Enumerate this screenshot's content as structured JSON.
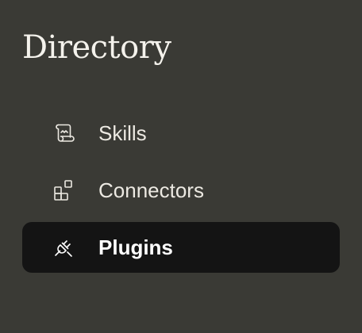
{
  "page": {
    "title": "Directory"
  },
  "nav": {
    "items": [
      {
        "label": "Skills",
        "icon": "scroll-icon",
        "active": false
      },
      {
        "label": "Connectors",
        "icon": "blocks-icon",
        "active": false
      },
      {
        "label": "Plugins",
        "icon": "plug-icon",
        "active": true
      }
    ]
  },
  "colors": {
    "background": "#3a3a35",
    "active_item_background": "#141414",
    "text": "#ece9e2"
  }
}
